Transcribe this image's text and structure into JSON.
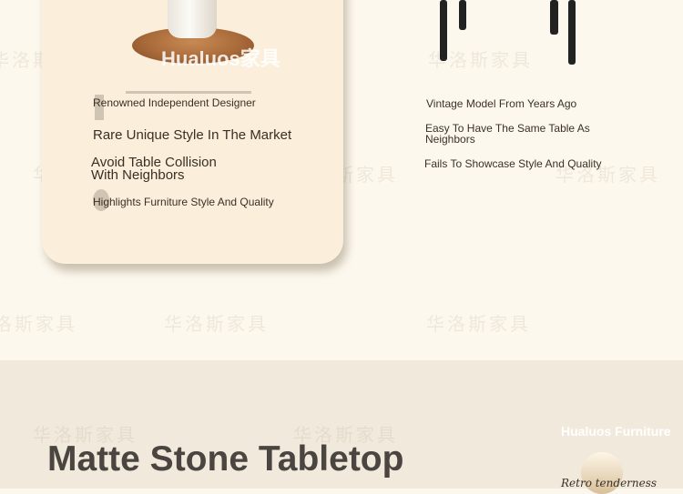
{
  "card": {
    "brand": "Hualuos家具",
    "designer": "Renowned Independent Designer",
    "headline": "Rare Unique Style In The Market",
    "collision_line1": "Avoid Table Collision",
    "collision_line2": "With Neighbors",
    "highlight": "Highlights Furniture Style And Quality"
  },
  "compare": {
    "item1": "Vintage Model From Years Ago",
    "item2_line1": "Easy To Have The Same Table As",
    "item2_line2": "Neighbors",
    "item3": "Fails To Showcase Style And Quality"
  },
  "section": {
    "title": "Matte Stone Tabletop",
    "brand_label": "Hualuos Furniture",
    "script_text": "Retro tenderness"
  },
  "watermarks": [
    "华洛斯家具"
  ],
  "colors": {
    "top_bg": "#fdf8ee",
    "card_bg": "#fbefdc",
    "bottom_bg": "#f1eadc",
    "title": "#4a4540"
  }
}
